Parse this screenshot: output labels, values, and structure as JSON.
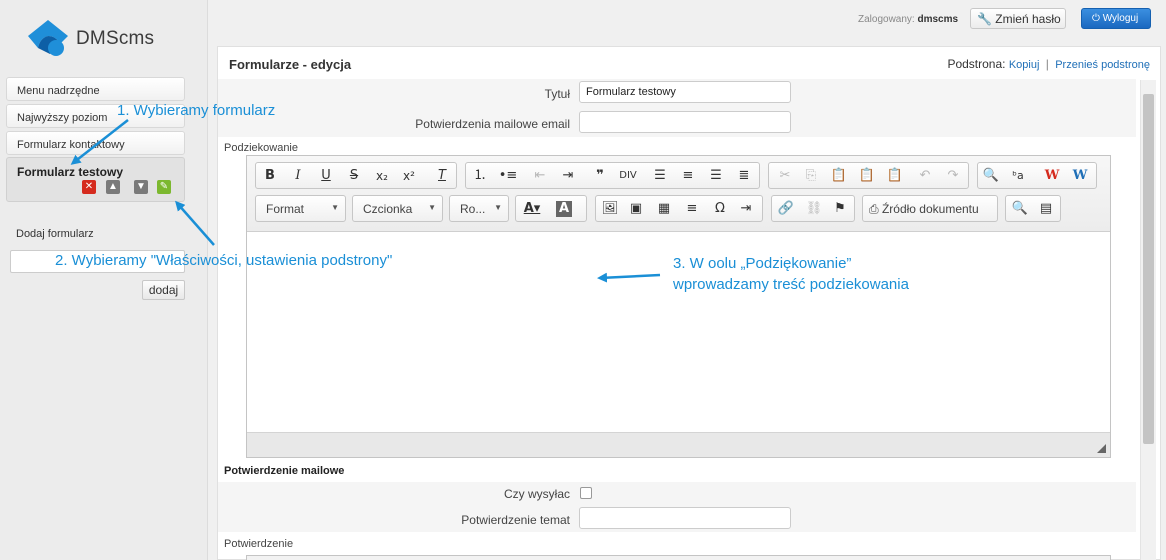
{
  "brand": {
    "name": "DMScms"
  },
  "sidebar": {
    "items": [
      {
        "label": "Menu nadrzędne"
      },
      {
        "label": "Najwyższy poziom"
      },
      {
        "label": "Formularz kontaktowy"
      }
    ],
    "active": {
      "label": "Formularz testowy"
    },
    "add_label": "Dodaj formularz",
    "add_value": "",
    "add_button": "dodaj"
  },
  "topbar": {
    "logged_label": "Zalogowany:",
    "user": "dmscms",
    "change_password": "Zmień hasło",
    "logout": "Wyloguj"
  },
  "panel": {
    "title": "Formularze - edycja",
    "subpage_label": "Podstrona:",
    "copy_link": "Kopiuj",
    "move_link": "Przenieś podstronę"
  },
  "form": {
    "title_label": "Tytuł",
    "title_value": "Formularz testowy",
    "email_confirm_label": "Potwierdzenia mailowe email",
    "email_confirm_value": "",
    "thanks_label": "Podziekowanie",
    "mail_section": "Potwierdzenie mailowe",
    "send_label": "Czy wysyłac",
    "send_checked": false,
    "subject_label": "Potwierdzenie temat",
    "subject_value": "",
    "confirm_label": "Potwierdzenie"
  },
  "editor": {
    "format_combo": "Format",
    "font_combo": "Czcionka",
    "size_combo": "Ro...",
    "source_button": "Źródło dokumentu"
  },
  "annotations": {
    "step1": "1. Wybieramy formularz",
    "step2": "2. Wybieramy \"Właściwości, ustawienia podstrony\"",
    "step3_line1": "3. W oolu „Podziękowanie”",
    "step3_line2": "wprowadzamy treść podziekowania"
  }
}
